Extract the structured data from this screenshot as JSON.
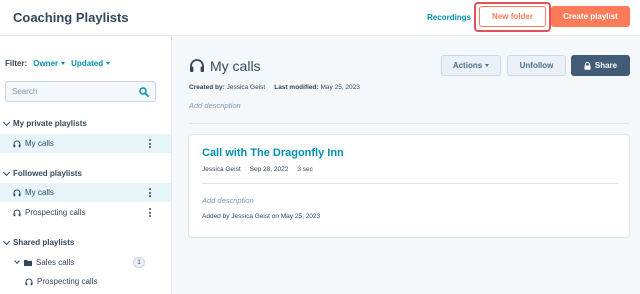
{
  "header": {
    "title": "Coaching Playlists",
    "recordings_label": "Recordings",
    "new_folder_label": "New folder",
    "create_playlist_label": "Create playlist"
  },
  "sidebar": {
    "filter_label": "Filter:",
    "filter_owner": "Owner",
    "filter_updated": "Updated",
    "search_placeholder": "Search",
    "sections": [
      {
        "title": "My private playlists",
        "items": [
          {
            "label": "My calls"
          }
        ]
      },
      {
        "title": "Followed playlists",
        "items": [
          {
            "label": "My calls"
          },
          {
            "label": "Prospecting calls"
          }
        ]
      },
      {
        "title": "Shared playlists",
        "folder": {
          "label": "Sales calls",
          "count": "1"
        },
        "items": [
          {
            "label": "Prospecting calls"
          }
        ]
      }
    ]
  },
  "main": {
    "title": "My calls",
    "created_by_label": "Created by:",
    "created_by_value": "Jessica Geist",
    "last_modified_label": "Last modified:",
    "last_modified_value": "May 25, 2023",
    "add_description": "Add description",
    "actions_label": "Actions",
    "unfollow_label": "Unfollow",
    "share_label": "Share",
    "call": {
      "title": "Call with The Dragonfly Inn",
      "owner": "Jessica Geist",
      "date": "Sep 28, 2022",
      "duration": "3 sec",
      "add_description": "Add description",
      "added_by": "Added by Jessica Geist on May 25, 2023"
    }
  },
  "colors": {
    "accent": "#ff7a59",
    "link": "#0091ae",
    "text": "#33475b",
    "highlight_ring": "#e0515c",
    "active_row": "#e5f5f8",
    "share_button": "#425b76"
  },
  "icons": {
    "search": "search-icon",
    "headset": "headset-icon",
    "folder": "folder-icon",
    "lock": "lock-icon",
    "kebab": "kebab-menu-icon",
    "chevron": "chevron-down-icon"
  }
}
